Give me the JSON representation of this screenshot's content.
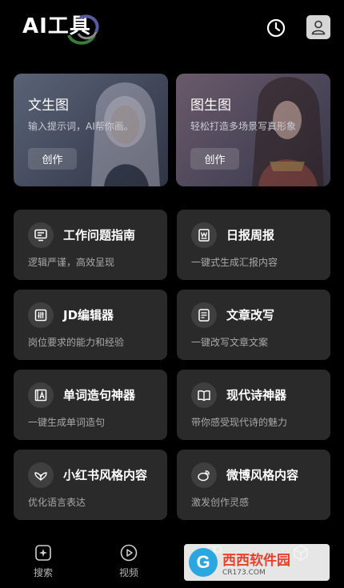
{
  "header": {
    "title": "AI工具",
    "history_icon": "clock-icon",
    "profile_icon": "user-icon"
  },
  "features": [
    {
      "title": "文生图",
      "subtitle": "输入提示词，AI帮你画。",
      "button": "创作"
    },
    {
      "title": "图生图",
      "subtitle": "轻松打造多场景写真形象",
      "button": "创作"
    }
  ],
  "tools": [
    {
      "title": "工作问题指南",
      "desc": "逻辑严谨，高效呈现",
      "icon": "monitor-icon"
    },
    {
      "title": "日报周报",
      "desc": "一键式生成汇报内容",
      "icon": "word-doc-icon"
    },
    {
      "title": "JD编辑器",
      "desc": "岗位要求的能力和经验",
      "icon": "sliders-icon"
    },
    {
      "title": "文章改写",
      "desc": "一键改写文章文案",
      "icon": "document-icon"
    },
    {
      "title": "单词造句神器",
      "desc": "一键生成单词造句",
      "icon": "letter-a-icon"
    },
    {
      "title": "现代诗神器",
      "desc": "带你感受现代诗的魅力",
      "icon": "open-book-icon"
    },
    {
      "title": "小红书风格内容",
      "desc": "优化语言表达",
      "icon": "leaf-icon"
    },
    {
      "title": "微博风格内容",
      "desc": "激发创作灵感",
      "icon": "weibo-icon"
    }
  ],
  "nav": [
    {
      "label": "搜索",
      "icon": "sparkle-search-icon"
    },
    {
      "label": "视频",
      "icon": "play-icon"
    },
    {
      "label": "",
      "icon": "grid-icon"
    },
    {
      "label": "",
      "icon": "cube-icon"
    }
  ],
  "watermark": {
    "logo": "G",
    "main": "西西软件园",
    "url": "CR173.COM"
  }
}
